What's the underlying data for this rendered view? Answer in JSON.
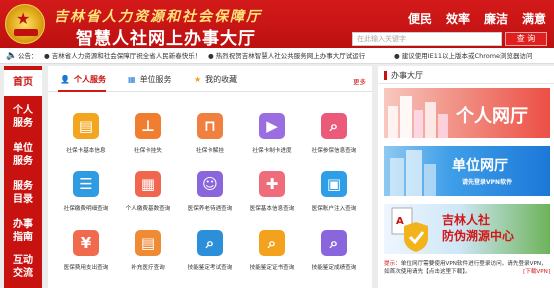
{
  "header": {
    "title_top": "吉林省人力资源和社会保障厅",
    "title_main": "智慧人社网上办事大厅",
    "nav": [
      "便民",
      "效率",
      "廉洁",
      "满意"
    ],
    "search_placeholder": "在此输入关键字",
    "search_button": "查 询"
  },
  "ticker": {
    "label": "公告：",
    "items": [
      "吉林省人力资源和社会保障厅祝全省人民新春快乐！",
      "热烈祝贺吉林智慧人社公共服务网上办事大厅试运行",
      "建议使用IE11以上版本或Chrome浏览器访问"
    ]
  },
  "sidebar": {
    "items": [
      {
        "label": "首页",
        "active": true
      },
      {
        "label": "个人\n服务",
        "active": false
      },
      {
        "label": "单位\n服务",
        "active": false
      },
      {
        "label": "服务\n目录",
        "active": false
      },
      {
        "label": "办事\n指南",
        "active": false
      },
      {
        "label": "互动\n交流",
        "active": false
      }
    ]
  },
  "tabs": [
    {
      "label": "个人服务",
      "icon": "person-icon",
      "active": true
    },
    {
      "label": "单位服务",
      "icon": "building-icon",
      "active": false
    },
    {
      "label": "我的收藏",
      "icon": "star-icon",
      "active": false
    }
  ],
  "more_label": "更多",
  "services": [
    {
      "label": "社保卡基本信息",
      "icon": "id-card-icon",
      "color": "#f3a520"
    },
    {
      "label": "社保卡挂失",
      "icon": "stamp-icon",
      "color": "#f07d30"
    },
    {
      "label": "社保卡解挂",
      "icon": "unlock-icon",
      "color": "#f08040"
    },
    {
      "label": "社保卡制卡进度",
      "icon": "progress-icon",
      "color": "#9a6ee0"
    },
    {
      "label": "社保参保信息查询",
      "icon": "search-doc-icon",
      "color": "#ec5a7a"
    },
    {
      "label": "社保缴费明细查询",
      "icon": "list-icon",
      "color": "#2f9be0"
    },
    {
      "label": "个人缴费基数查询",
      "icon": "calculator-icon",
      "color": "#f0664e"
    },
    {
      "label": "医保养老待遇查询",
      "icon": "person-card-icon",
      "color": "#8a66dc"
    },
    {
      "label": "医保基本信息查询",
      "icon": "medical-icon",
      "color": "#ef6d7a"
    },
    {
      "label": "医保账户注入查询",
      "icon": "account-icon",
      "color": "#2e9ee6"
    },
    {
      "label": "医保费用支出查询",
      "icon": "receipt-icon",
      "color": "#f06a4e"
    },
    {
      "label": "补充医疗查询",
      "icon": "document-icon",
      "color": "#ef8a35"
    },
    {
      "label": "技能鉴定考试查询",
      "icon": "exam-icon",
      "color": "#2c8fd9"
    },
    {
      "label": "技能鉴定证书查询",
      "icon": "certificate-icon",
      "color": "#f2a21c"
    },
    {
      "label": "技能鉴定成绩查询",
      "icon": "score-icon",
      "color": "#8a66dc"
    }
  ],
  "right": {
    "title": "办事大厅",
    "banners": [
      {
        "text": "个人网厅",
        "sub": ""
      },
      {
        "text": "单位网厅",
        "sub": "请先登录VPN软件"
      },
      {
        "text": "吉林人社\n防伪溯源中心",
        "sub": ""
      }
    ],
    "note_prefix": "提示：",
    "note": "单位网厅需要使用VPN软件进行登录访问，请先登录VPN，如首次使用请先【点击这里下载】。",
    "note_link": "[下载VPN]"
  }
}
